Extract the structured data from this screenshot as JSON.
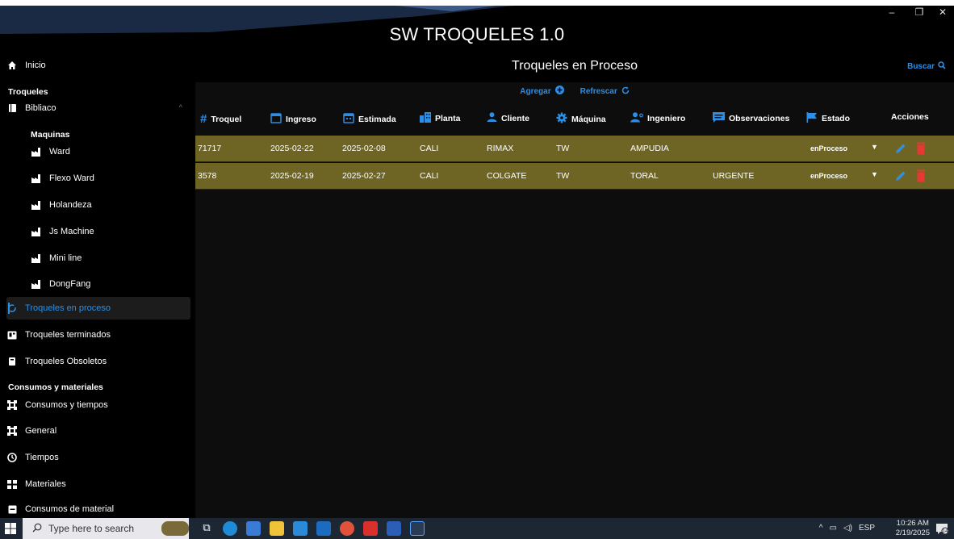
{
  "app": {
    "title": "SW TROQUELES 1.0"
  },
  "window_controls": {
    "minimize": "–",
    "maximize": "❐",
    "close": "✕"
  },
  "sidebar": {
    "home": "Inicio",
    "section_troqueles": "Troqueles",
    "bibliaco": "Bibliaco",
    "maquinas_heading": "Maquinas",
    "machines": [
      "Ward",
      "Flexo Ward",
      "Holandeza",
      "Js Machine",
      "Mini line",
      "DongFang"
    ],
    "in_process": "Troqueles en proceso",
    "finished": "Troqueles terminados",
    "obsolete": "Troqueles Obsoletos",
    "section_consumos": "Consumos  y materiales",
    "consumos_tiempos": "Consumos y tiempos",
    "general": "General",
    "tiempos": "Tiempos",
    "materiales": "Materiales",
    "consumos_material": "Consumos de material"
  },
  "panel": {
    "title": "Troqueles en Proceso",
    "search": "Buscar",
    "add": "Agregar",
    "refresh": "Refrescar"
  },
  "table": {
    "headers": [
      "Troquel",
      "Ingreso",
      "Estimada",
      "Planta",
      "Cliente",
      "Máquina",
      "Ingeniero",
      "Observaciones",
      "Estado",
      "Acciones"
    ],
    "rows": [
      [
        "71717",
        "2025-02-22",
        "2025-02-08",
        "CALI",
        "RIMAX",
        "TW",
        "AMPUDIA",
        "",
        "enProceso"
      ],
      [
        "3578",
        "2025-02-19",
        "2025-02-27",
        "CALI",
        "COLGATE",
        "TW",
        "TORAL",
        "URGENTE",
        "enProceso"
      ]
    ],
    "row_color": "#6e6524"
  },
  "taskbar": {
    "search_placeholder": "Type here to search",
    "tray_lang": "ESP",
    "time": "10:26 AM",
    "date": "2/19/2025",
    "notif_count": "14"
  },
  "colors": {
    "accent": "#2d8ee6",
    "delete": "#e53935"
  }
}
